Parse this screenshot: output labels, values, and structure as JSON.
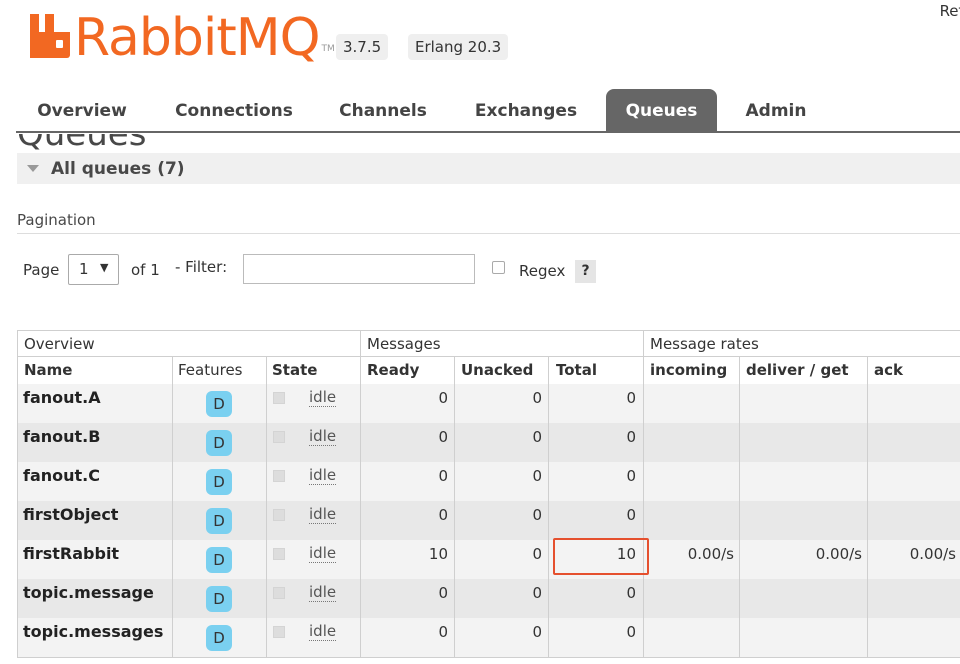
{
  "header": {
    "brand": "RabbitMQ",
    "tm": "TM",
    "version": "3.7.5",
    "erlang": "Erlang 20.3",
    "refresh_text": "Refr",
    "brand_color": "#f26822"
  },
  "tabs": [
    "Overview",
    "Connections",
    "Channels",
    "Exchanges",
    "Queues",
    "Admin"
  ],
  "active_tab": "Queues",
  "page_title": "Queues",
  "section": {
    "label": "All queues (7)"
  },
  "pagination": {
    "heading": "Pagination",
    "page_label": "Page",
    "page_value": "1",
    "of_label": "of 1",
    "filter_label": "- Filter:",
    "filter_value": "",
    "regex_label": "Regex",
    "help_label": "?"
  },
  "table": {
    "groups": [
      "Overview",
      "Messages",
      "Message rates"
    ],
    "columns": [
      "Name",
      "Features",
      "State",
      "Ready",
      "Unacked",
      "Total",
      "incoming",
      "deliver / get",
      "ack"
    ],
    "rows": [
      {
        "name": "fanout.A",
        "feature": "D",
        "state": "idle",
        "ready": "0",
        "unacked": "0",
        "total": "0",
        "incoming": "",
        "deliver": "",
        "ack": ""
      },
      {
        "name": "fanout.B",
        "feature": "D",
        "state": "idle",
        "ready": "0",
        "unacked": "0",
        "total": "0",
        "incoming": "",
        "deliver": "",
        "ack": ""
      },
      {
        "name": "fanout.C",
        "feature": "D",
        "state": "idle",
        "ready": "0",
        "unacked": "0",
        "total": "0",
        "incoming": "",
        "deliver": "",
        "ack": ""
      },
      {
        "name": "firstObject",
        "feature": "D",
        "state": "idle",
        "ready": "0",
        "unacked": "0",
        "total": "0",
        "incoming": "",
        "deliver": "",
        "ack": ""
      },
      {
        "name": "firstRabbit",
        "feature": "D",
        "state": "idle",
        "ready": "10",
        "unacked": "0",
        "total": "10",
        "incoming": "0.00/s",
        "deliver": "0.00/s",
        "ack": "0.00/s"
      },
      {
        "name": "topic.message",
        "feature": "D",
        "state": "idle",
        "ready": "0",
        "unacked": "0",
        "total": "0",
        "incoming": "",
        "deliver": "",
        "ack": ""
      },
      {
        "name": "topic.messages",
        "feature": "D",
        "state": "idle",
        "ready": "0",
        "unacked": "0",
        "total": "0",
        "incoming": "",
        "deliver": "",
        "ack": ""
      }
    ],
    "highlight_color": "#e5502e"
  }
}
